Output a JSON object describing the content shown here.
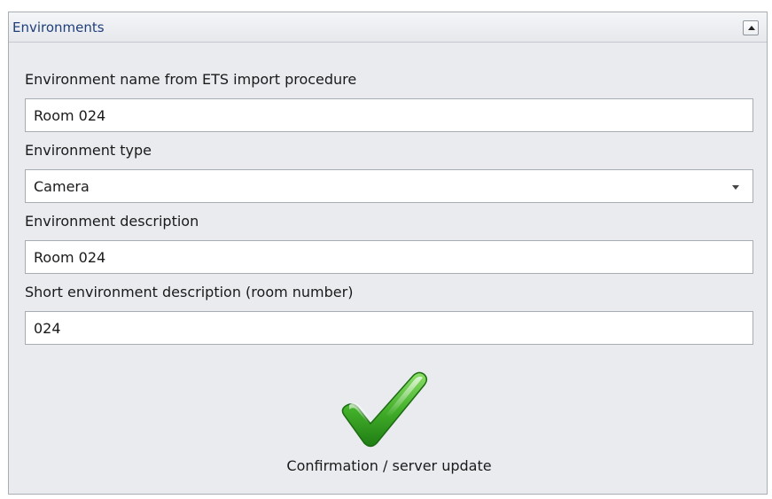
{
  "panel": {
    "title": "Environments",
    "collapse_icon": "collapse-up-icon"
  },
  "fields": {
    "name": {
      "label": "Environment name from ETS import procedure",
      "value": "Room 024"
    },
    "type": {
      "label": "Environment type",
      "value": "Camera"
    },
    "description": {
      "label": "Environment description",
      "value": "Room 024"
    },
    "short_description": {
      "label": "Short environment description (room number)",
      "value": "024"
    }
  },
  "confirm": {
    "label": "Confirmation / server update",
    "icon": "checkmark-icon"
  }
}
